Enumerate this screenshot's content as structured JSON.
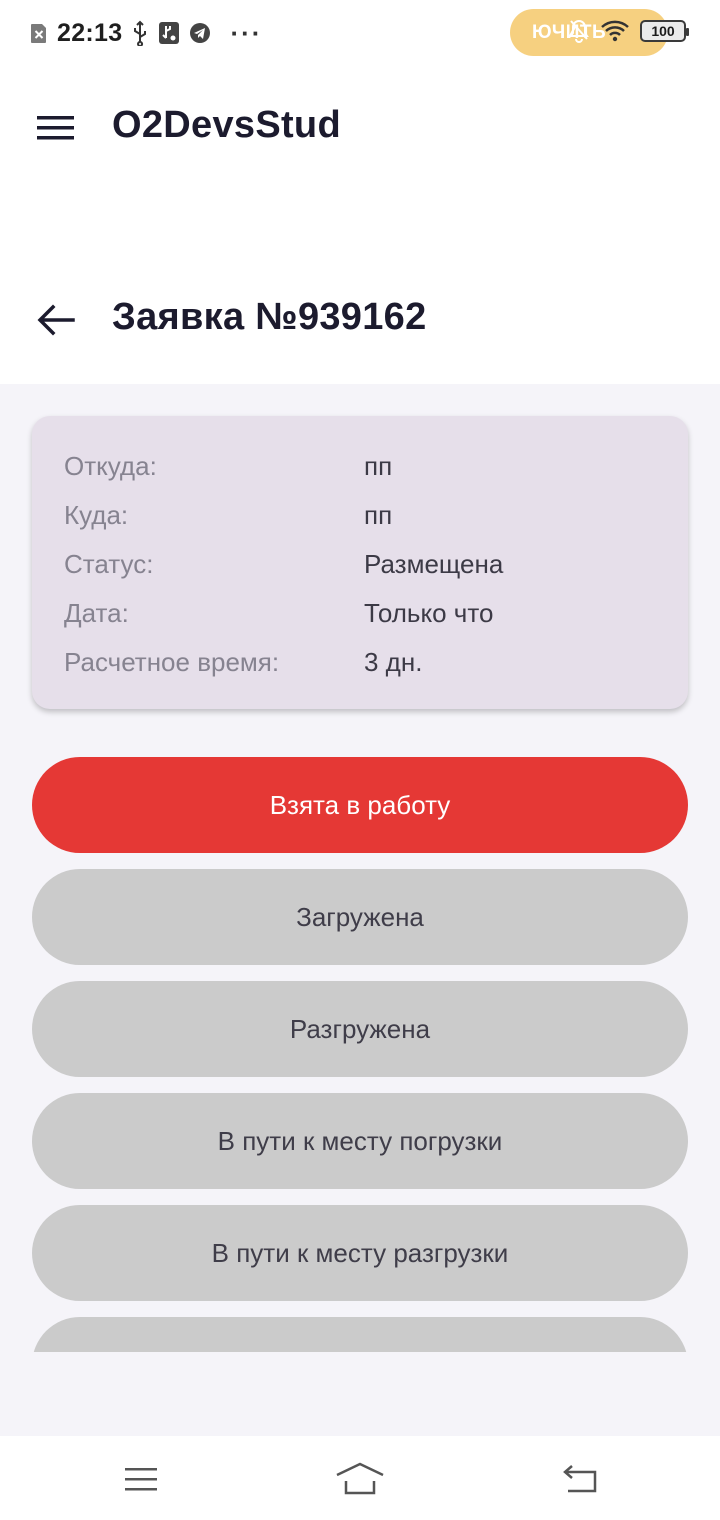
{
  "status_bar": {
    "time": "22:13",
    "overflow": "···",
    "pill_text": "ЮЧИТЬ",
    "battery_level": "100",
    "icons": [
      "close-notification-icon",
      "usb-icon",
      "usb-debug-icon",
      "telegram-icon",
      "mute-bell-icon",
      "wifi-icon",
      "battery-icon"
    ]
  },
  "app_bar": {
    "title": "O2DevsStud",
    "menu_icon": "hamburger-menu-icon"
  },
  "page": {
    "title": "Заявка №939162",
    "back_icon": "arrow-left-icon"
  },
  "order": {
    "rows": [
      {
        "label": "Откуда:",
        "value": "пп"
      },
      {
        "label": "Куда:",
        "value": "пп"
      },
      {
        "label": "Статус:",
        "value": "Размещена"
      },
      {
        "label": "Дата:",
        "value": "Только что"
      },
      {
        "label": "Расчетное время:",
        "value": "3 дн."
      }
    ]
  },
  "status_buttons": [
    {
      "label": "Взята в работу",
      "active": true
    },
    {
      "label": "Загружена",
      "active": false
    },
    {
      "label": "Разгружена",
      "active": false
    },
    {
      "label": "В пути к месту погрузки",
      "active": false
    },
    {
      "label": "В пути к месту разгрузки",
      "active": false
    },
    {
      "label": "",
      "active": false
    }
  ],
  "colors": {
    "accent": "#e53835",
    "button_idle": "#cbcbcb",
    "card": "#e6dfea",
    "background": "#f5f4f9",
    "title": "#1c1b2e"
  },
  "nav_bar": {
    "icons": [
      "recents-menu-icon",
      "home-icon",
      "back-icon"
    ]
  }
}
